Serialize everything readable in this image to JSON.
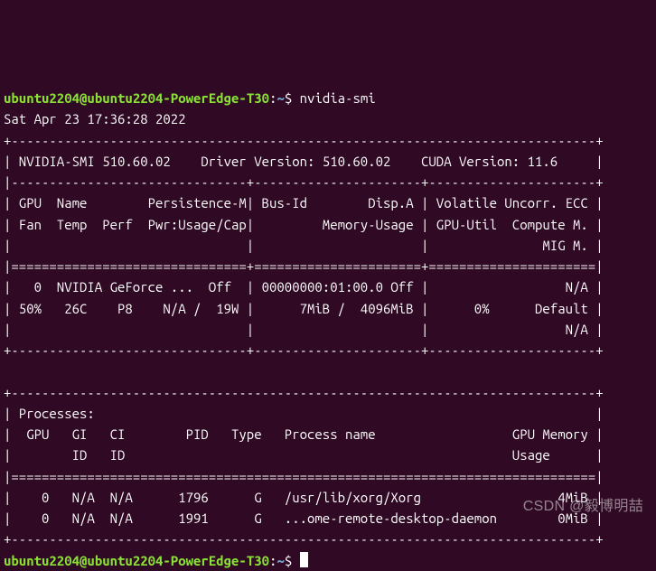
{
  "prompt1": {
    "user": "ubuntu2204",
    "at": "@",
    "host": "ubuntu2204-PowerEdge-T30",
    "colon": ":",
    "path": "~",
    "dollar": "$ ",
    "cmd": "nvidia-smi"
  },
  "timestamp": "Sat Apr 23 17:36:28 2022",
  "divider_top": "+-----------------------------------------------------------------------------+",
  "header_line": "| NVIDIA-SMI 510.60.02    Driver Version: 510.60.02    CUDA Version: 11.6     |",
  "sep3": "|-------------------------------+----------------------+----------------------+",
  "col_h1": "| GPU  Name        Persistence-M| Bus-Id        Disp.A | Volatile Uncorr. ECC |",
  "col_h2": "| Fan  Temp  Perf  Pwr:Usage/Cap|         Memory-Usage | GPU-Util  Compute M. |",
  "col_h3": "|                               |                      |               MIG M. |",
  "sep3eq": "|===============================+======================+======================|",
  "gpu_row1": "|   0  NVIDIA GeForce ...  Off  | 00000000:01:00.0 Off |                  N/A |",
  "gpu_row2": "| 50%   26C    P8    N/A /  19W |      7MiB /  4096MiB |      0%      Default |",
  "gpu_row3": "|                               |                      |                  N/A |",
  "sep3_bottom": "+-------------------------------+----------------------+----------------------+",
  "blank": "                                                                               ",
  "proc_top": "+-----------------------------------------------------------------------------+",
  "proc_title": "| Processes:                                                                  |",
  "proc_h1": "|  GPU   GI   CI        PID   Type   Process name                  GPU Memory |",
  "proc_h2": "|        ID   ID                                                   Usage      |",
  "proc_sep": "|=============================================================================|",
  "proc_row1": "|    0   N/A  N/A      1796      G   /usr/lib/xorg/Xorg                  4MiB |",
  "proc_row2": "|    0   N/A  N/A      1991      G   ...ome-remote-desktop-daemon        0MiB |",
  "proc_bottom": "+-----------------------------------------------------------------------------+",
  "prompt2": {
    "user": "ubuntu2204",
    "at": "@",
    "host": "ubuntu2204-PowerEdge-T30",
    "colon": ":",
    "path": "~",
    "dollar": "$ "
  },
  "watermark": "CSDN @毅博明喆"
}
